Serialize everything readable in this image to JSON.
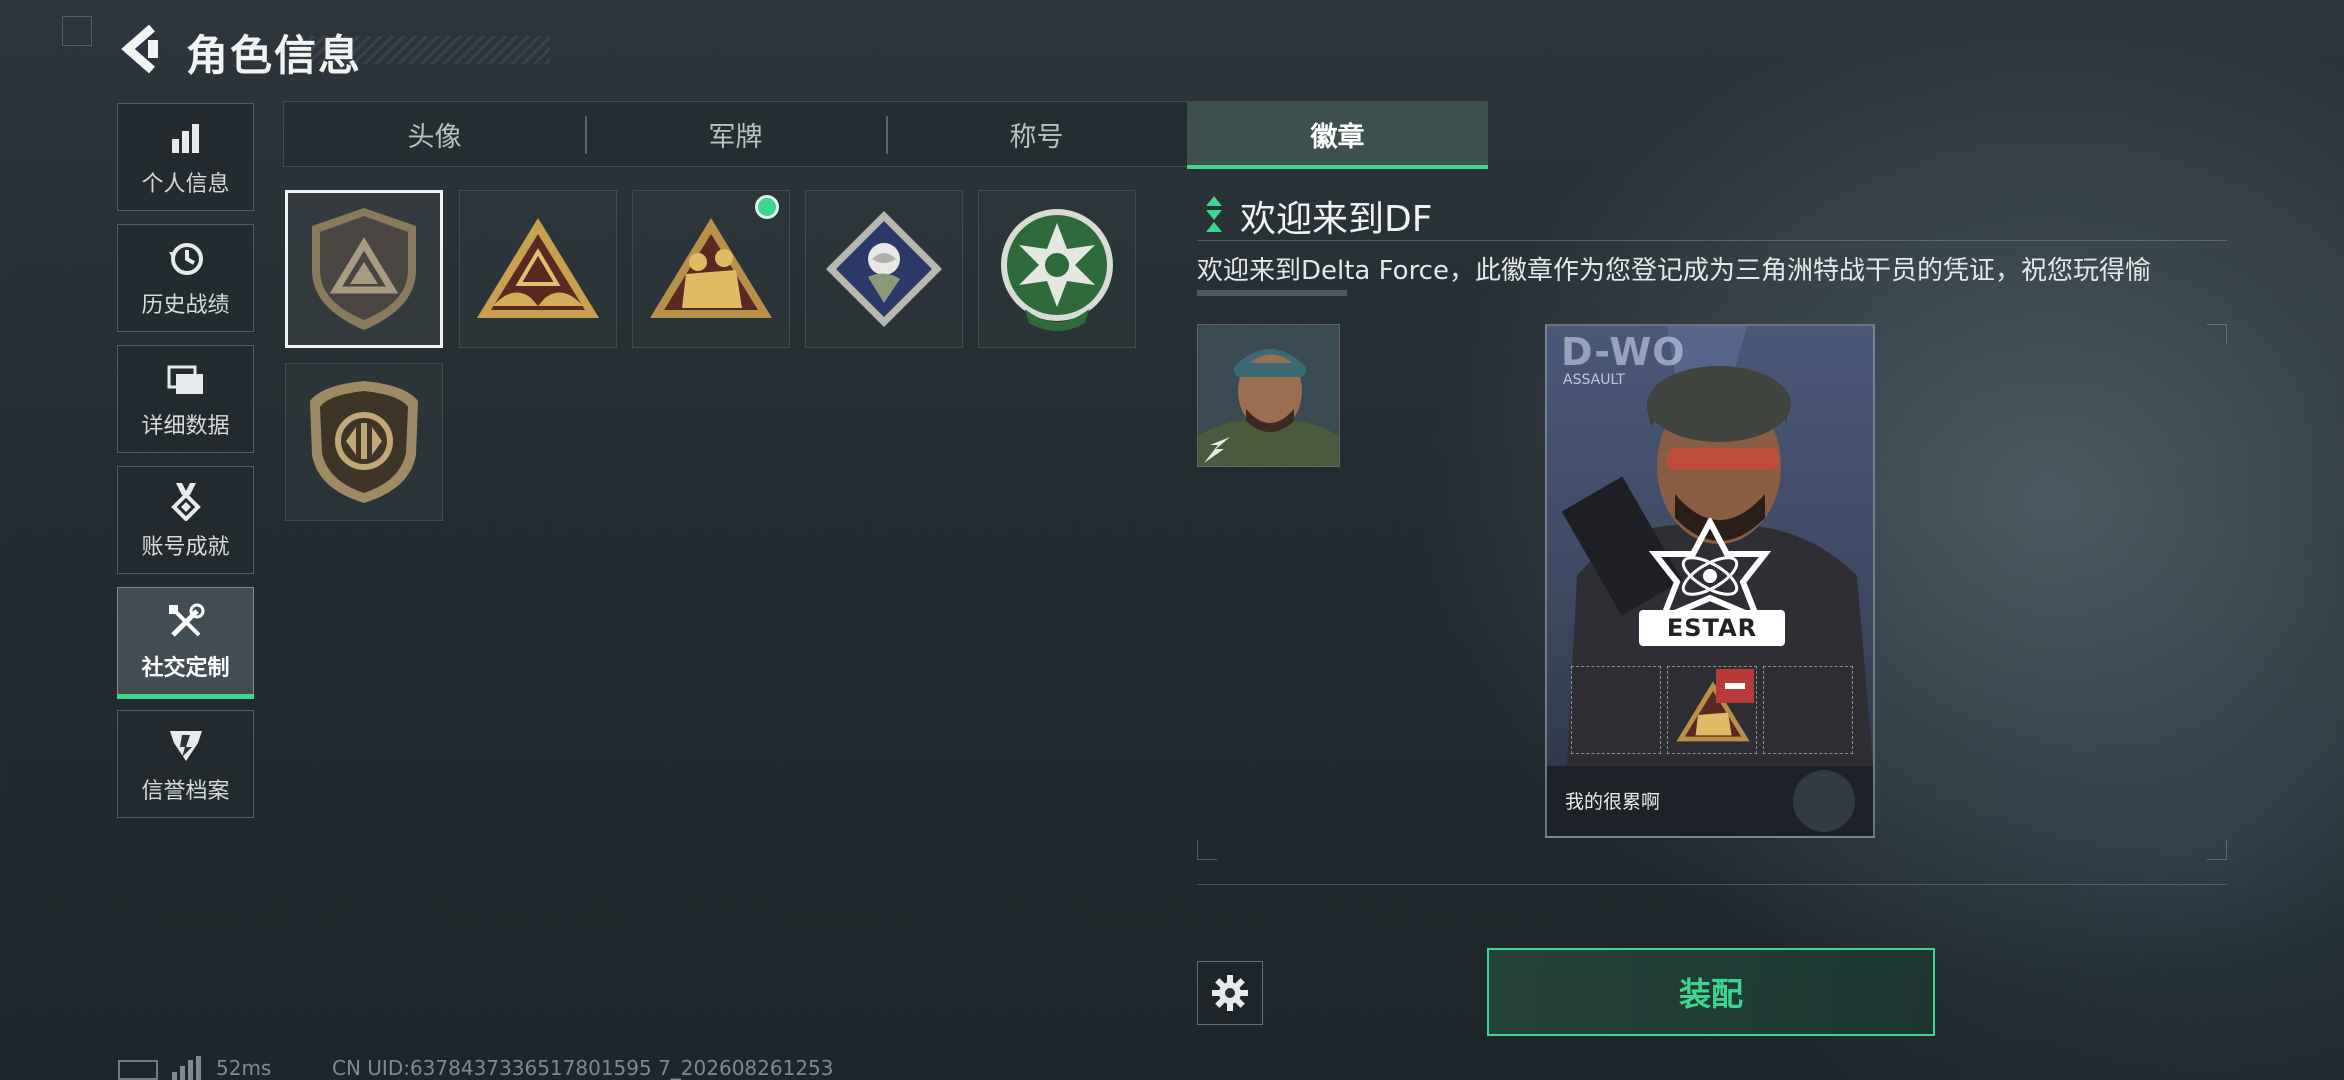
{
  "header": {
    "title": "角色信息"
  },
  "nav": {
    "items": [
      {
        "label": "个人信息",
        "icon": "bar-chart-icon",
        "active": false
      },
      {
        "label": "历史战绩",
        "icon": "history-clock-icon",
        "active": false
      },
      {
        "label": "详细数据",
        "icon": "folders-icon",
        "active": false
      },
      {
        "label": "账号成就",
        "icon": "medal-icon",
        "active": false
      },
      {
        "label": "社交定制",
        "icon": "tools-icon",
        "active": true
      },
      {
        "label": "信誉档案",
        "icon": "reputation-shield-icon",
        "active": false
      }
    ]
  },
  "tabs": [
    {
      "label": "头像",
      "active": false
    },
    {
      "label": "军牌",
      "active": false
    },
    {
      "label": "称号",
      "active": false
    },
    {
      "label": "徽章",
      "active": true
    }
  ],
  "badges": [
    {
      "icon": "grey-shield-triangle-badge-icon",
      "selected": true,
      "equipped": false
    },
    {
      "icon": "gold-triangle-hands-badge-icon",
      "selected": false,
      "equipped": false
    },
    {
      "icon": "gold-soldiers-triangle-badge-icon",
      "selected": false,
      "equipped": true
    },
    {
      "icon": "rose-diamond-badge-icon",
      "selected": false,
      "equipped": false
    },
    {
      "icon": "green-star-emblem-badge-icon",
      "selected": false,
      "equipped": false
    },
    {
      "icon": "bronze-shield-badge-icon",
      "selected": false,
      "equipped": false
    }
  ],
  "detail": {
    "title": "欢迎来到DF",
    "description": "欢迎来到Delta Force，此徽章作为您登记成为三角洲特战干员的凭证，祝您玩得愉"
  },
  "card": {
    "codename": "D-WO",
    "role": "ASSAULT",
    "team_logo_text": "ESTAR",
    "signature": "我的很累啊"
  },
  "actions": {
    "equip_label": "装配"
  },
  "status_bar": {
    "ping": "52ms",
    "uid": "CN UID:6378437336517801595 7_202608261253"
  },
  "colors": {
    "accent": "#3ed58e",
    "background": "#232c31",
    "panel": "#2d363a"
  }
}
